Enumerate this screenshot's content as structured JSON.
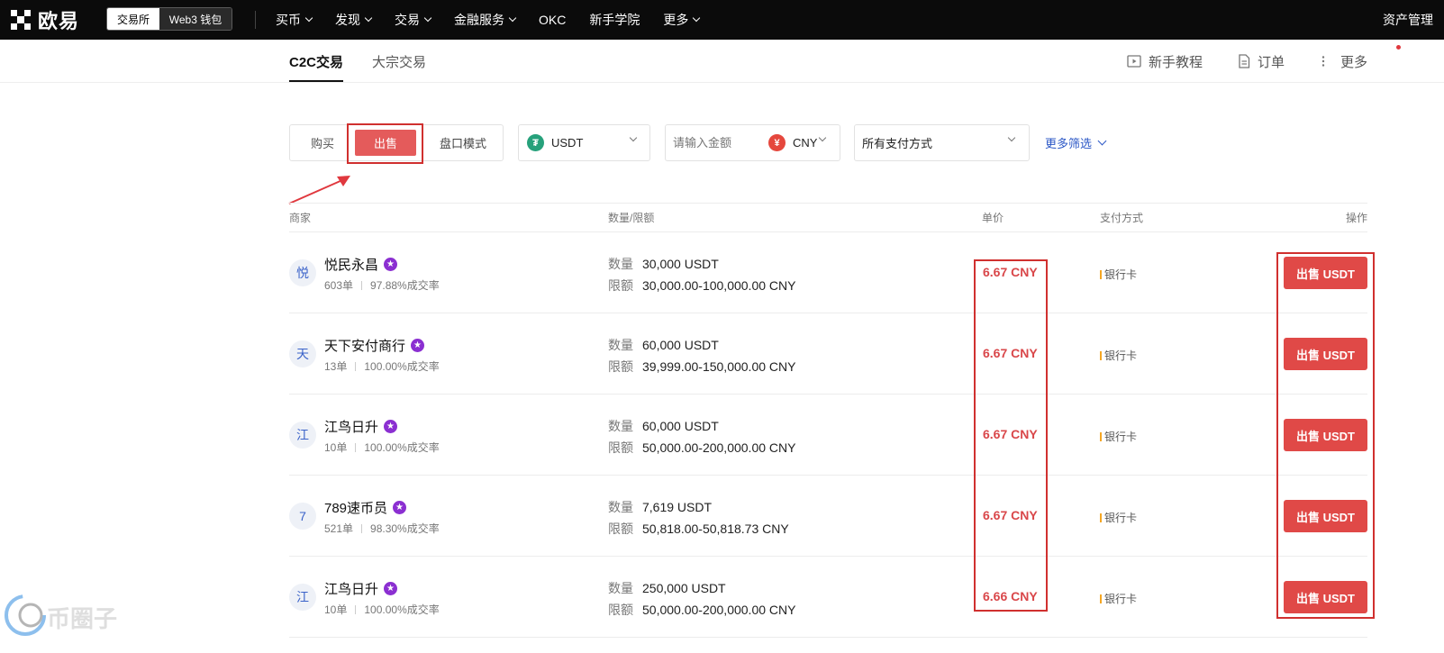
{
  "brand": {
    "logo_text": "欧易"
  },
  "topnav": {
    "mode_exchange": "交易所",
    "mode_web3": "Web3 钱包",
    "items": [
      {
        "label": "买币",
        "dropdown": true
      },
      {
        "label": "发现",
        "dropdown": true
      },
      {
        "label": "交易",
        "dropdown": true
      },
      {
        "label": "金融服务",
        "dropdown": true
      },
      {
        "label": "OKC",
        "dropdown": false
      },
      {
        "label": "新手学院",
        "dropdown": false
      },
      {
        "label": "更多",
        "dropdown": true
      }
    ],
    "asset_management": "资产管理"
  },
  "subnav": {
    "tabs": [
      {
        "label": "C2C交易",
        "active": true
      },
      {
        "label": "大宗交易",
        "active": false
      }
    ],
    "tutorial": "新手教程",
    "orders": "订单",
    "more": "更多"
  },
  "filters": {
    "buy": "购买",
    "sell": "出售",
    "orderbook": "盘口模式",
    "coin": "USDT",
    "amount_placeholder": "请输入金额",
    "fiat": "CNY",
    "fiat_icon": "¥",
    "payment": "所有支付方式",
    "more_filters": "更多筛选"
  },
  "table": {
    "headers": {
      "merchant": "商家",
      "quantity_limit": "数量/限额",
      "price": "单价",
      "payment": "支付方式",
      "action": "操作"
    },
    "qty_label": "数量",
    "limit_label": "限额",
    "rows": [
      {
        "avatar": "悦",
        "name": "悦民永昌",
        "orders": "603单",
        "rate": "97.88%成交率",
        "quantity": "30,000 USDT",
        "limit": "30,000.00-100,000.00 CNY",
        "price": "6.67 CNY",
        "payment": "银行卡",
        "action": "出售 USDT"
      },
      {
        "avatar": "天",
        "name": "天下安付商行",
        "orders": "13单",
        "rate": "100.00%成交率",
        "quantity": "60,000 USDT",
        "limit": "39,999.00-150,000.00 CNY",
        "price": "6.67 CNY",
        "payment": "银行卡",
        "action": "出售 USDT"
      },
      {
        "avatar": "江",
        "name": "江鸟日升",
        "orders": "10单",
        "rate": "100.00%成交率",
        "quantity": "60,000 USDT",
        "limit": "50,000.00-200,000.00 CNY",
        "price": "6.67 CNY",
        "payment": "银行卡",
        "action": "出售 USDT"
      },
      {
        "avatar": "7",
        "name": "789速币员",
        "orders": "521单",
        "rate": "98.30%成交率",
        "quantity": "7,619 USDT",
        "limit": "50,818.00-50,818.73 CNY",
        "price": "6.67 CNY",
        "payment": "银行卡",
        "action": "出售 USDT"
      },
      {
        "avatar": "江",
        "name": "江鸟日升",
        "orders": "10单",
        "rate": "100.00%成交率",
        "quantity": "250,000 USDT",
        "limit": "50,000.00-200,000.00 CNY",
        "price": "6.66 CNY",
        "payment": "银行卡",
        "action": "出售 USDT"
      }
    ]
  },
  "watermark": {
    "text": "币圈子"
  },
  "colors": {
    "accent_red": "#e04947",
    "price_red": "#d9474a",
    "link_blue": "#2b57c6",
    "nav_bg": "#0b0b0b",
    "usdt_green": "#26a17b",
    "cny_red": "#e5473d"
  }
}
